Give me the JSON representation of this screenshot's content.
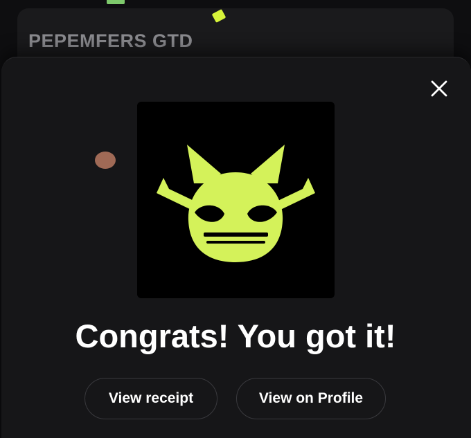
{
  "background_card": {
    "title": "PEPEMFERS GTD"
  },
  "modal": {
    "close_icon": "close-icon",
    "artwork": {
      "icon": "pepemfers-logo",
      "background": "#000000",
      "accent": "#d4f25a"
    },
    "headline": "Congrats! You got it!",
    "buttons": {
      "view_receipt": "View receipt",
      "view_on_profile": "View on Profile"
    }
  },
  "colors": {
    "page_background": "#0e0e10",
    "sheet_background": "#161618",
    "button_border": "#3a3a3e",
    "text": "#ffffff",
    "muted_text": "#8a8a8e",
    "confetti": [
      "#7ec96c",
      "#d7f43a",
      "#a06a56"
    ]
  }
}
